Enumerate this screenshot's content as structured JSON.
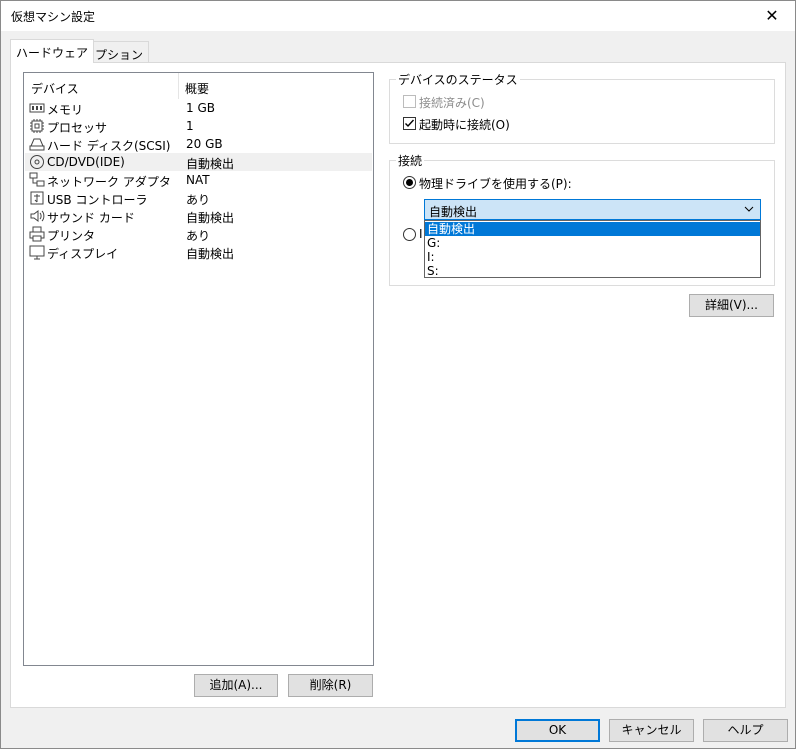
{
  "window": {
    "title": "仮想マシン設定",
    "close_glyph": "✕"
  },
  "tabs": [
    {
      "label": "ハードウェア"
    },
    {
      "label": "オプション"
    }
  ],
  "device_list": {
    "columns": [
      "デバイス",
      "概要"
    ],
    "rows": [
      {
        "name": "メモリ",
        "summary": "1 GB",
        "icon": "memory-icon"
      },
      {
        "name": "プロセッサ",
        "summary": "1",
        "icon": "processor-icon"
      },
      {
        "name": "ハード ディスク(SCSI)",
        "summary": "20 GB",
        "icon": "hard-disk-icon"
      },
      {
        "name": "CD/DVD(IDE)",
        "summary": "自動検出",
        "icon": "cd-dvd-icon",
        "selected": true
      },
      {
        "name": "ネットワーク アダプタ",
        "summary": "NAT",
        "icon": "network-adapter-icon"
      },
      {
        "name": "USB コントローラ",
        "summary": "あり",
        "icon": "usb-icon"
      },
      {
        "name": "サウンド カード",
        "summary": "自動検出",
        "icon": "speaker-icon"
      },
      {
        "name": "プリンタ",
        "summary": "あり",
        "icon": "printer-icon"
      },
      {
        "name": "ディスプレイ",
        "summary": "自動検出",
        "icon": "display-icon"
      }
    ]
  },
  "list_buttons": {
    "add": "追加(A)...",
    "remove": "削除(R)"
  },
  "device_status": {
    "title": "デバイスのステータス",
    "connected": {
      "label": "接続済み(C)",
      "checked": false,
      "disabled": true
    },
    "connect_at_power_on": {
      "label": "起動時に接続(O)",
      "checked": true
    }
  },
  "connection": {
    "title": "接続",
    "physical_drive": {
      "label": "物理ドライブを使用する(P):",
      "selected": true
    },
    "drive_select": {
      "value": "自動検出",
      "options": [
        "自動検出",
        "G:",
        "I:",
        "S:"
      ],
      "highlighted": 0
    },
    "iso_radio_partial": "I"
  },
  "advanced_button": "詳細(V)...",
  "footer": {
    "ok": "OK",
    "cancel": "キャンセル",
    "help": "ヘルプ"
  },
  "colors": {
    "accent": "#0078d7",
    "dropdown_highlight": "#0078d7",
    "combo_bg": "#cce4f7"
  }
}
